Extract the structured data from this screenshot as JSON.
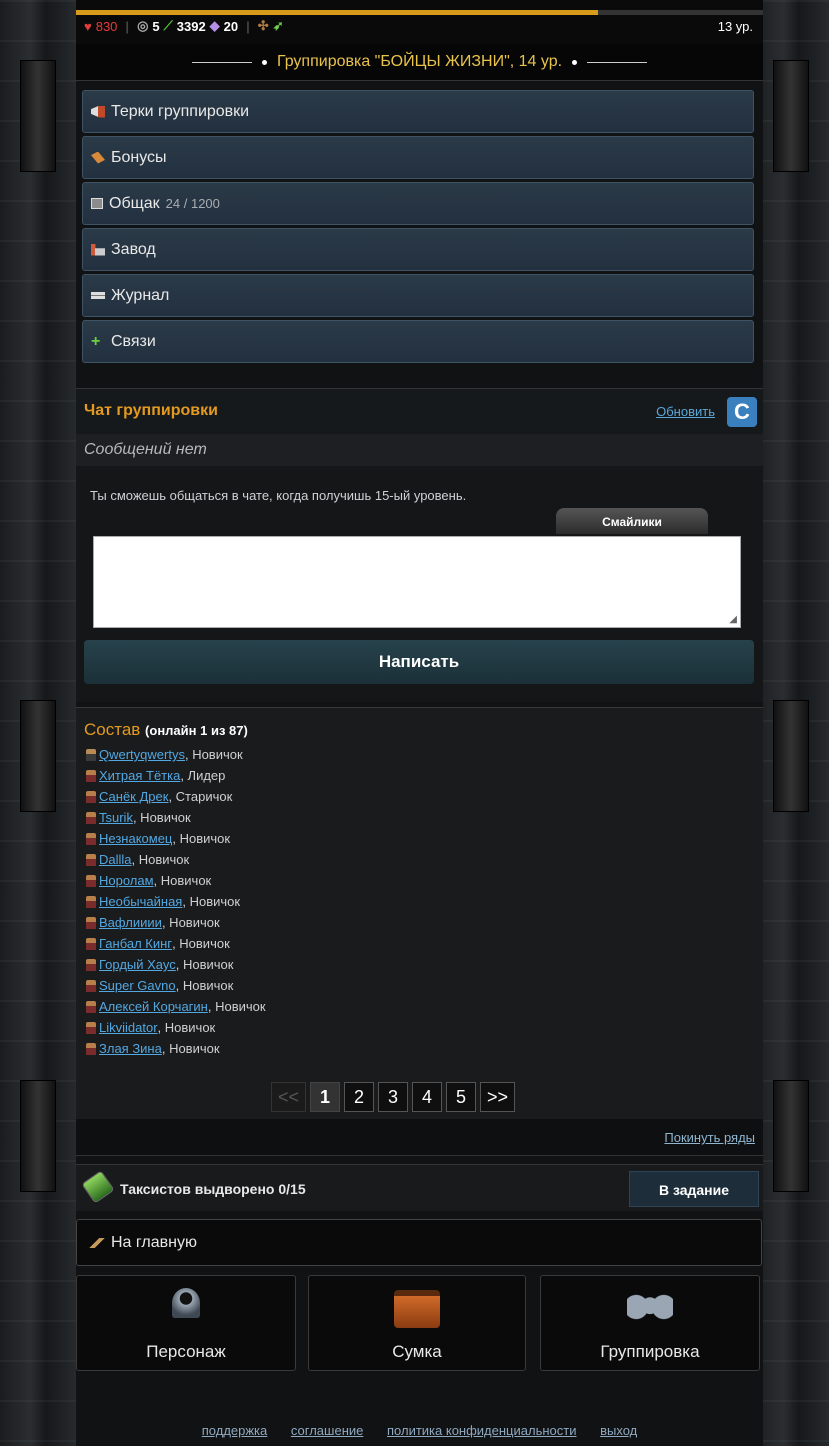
{
  "top_bar": {
    "hp": "830",
    "gems": "5",
    "money": "3392",
    "crystals": "20",
    "level": "13 ур.",
    "xp_progress": 0.76
  },
  "gang": {
    "title": "Группировка \"БОЙЦЫ ЖИЗНИ\", 14 ур."
  },
  "menu": {
    "items": [
      {
        "label": "Терки группировки",
        "icon": "megaphone-icon"
      },
      {
        "label": "Бонусы",
        "icon": "bonus-icon"
      },
      {
        "label": "Общак",
        "count": "24 / 1200",
        "icon": "safe-icon"
      },
      {
        "label": "Завод",
        "icon": "factory-icon"
      },
      {
        "label": "Журнал",
        "icon": "journal-icon"
      },
      {
        "label": "Связи",
        "icon": "plus-icon"
      }
    ]
  },
  "chat": {
    "title": "Чат группировки",
    "refresh_label": "Обновить",
    "empty_text": "Сообщений нет",
    "note": "Ты сможешь общаться в чате, когда получишь 15-ый уровень.",
    "smileys_label": "Смайлики",
    "input_value": "",
    "write_label": "Написать"
  },
  "members": {
    "title": "Состав",
    "online": "(онлайн 1 из 87)",
    "list": [
      {
        "nick": "Qwertyqwertys",
        "rank": ", Новичок",
        "leader_style": true
      },
      {
        "nick": "Хитрая Тётка",
        "rank": ", Лидер"
      },
      {
        "nick": "Санёк Дрек",
        "rank": ", Старичок"
      },
      {
        "nick": "Tsurik",
        "rank": ", Новичок"
      },
      {
        "nick": "Незнакомец",
        "rank": ", Новичок"
      },
      {
        "nick": "Dallla",
        "rank": ", Новичок"
      },
      {
        "nick": "Норолам",
        "rank": ", Новичок"
      },
      {
        "nick": "Необычайная",
        "rank": ", Новичок"
      },
      {
        "nick": "Вафлииии",
        "rank": ", Новичок"
      },
      {
        "nick": "Ганбал Кинг",
        "rank": ", Новичок"
      },
      {
        "nick": "Гордый Хаус",
        "rank": ", Новичок"
      },
      {
        "nick": "Super Gavno",
        "rank": ", Новичок"
      },
      {
        "nick": "Алексей Корчагин",
        "rank": ", Новичок"
      },
      {
        "nick": "Likviidator",
        "rank": ", Новичок"
      },
      {
        "nick": "Злая Зина",
        "rank": ", Новичок"
      }
    ],
    "pager": {
      "prev": "<<",
      "pages": [
        "1",
        "2",
        "3",
        "4",
        "5"
      ],
      "next": ">>",
      "current": "1"
    },
    "leave_label": "Покинуть ряды"
  },
  "task": {
    "label": "Таксистов выдворено 0/15",
    "button": "В задание"
  },
  "home": {
    "label": "На главную"
  },
  "nav": [
    {
      "label": "Персонаж",
      "icon": "character-icon"
    },
    {
      "label": "Сумка",
      "icon": "bag-icon"
    },
    {
      "label": "Группировка",
      "icon": "group-icon"
    }
  ],
  "footer": {
    "links": [
      "поддержка",
      "соглашение",
      "политика конфиденциальности",
      "выход"
    ]
  },
  "colors": {
    "accent": "#e39a1e",
    "link": "#53a8e2",
    "menu_bg": "#2b3a47",
    "gang_title": "#e8c24a"
  }
}
